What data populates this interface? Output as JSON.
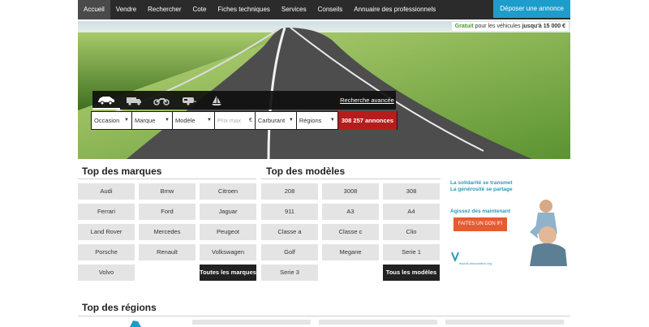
{
  "nav": {
    "items": [
      "Accueil",
      "Vendre",
      "Rechercher",
      "Cote",
      "Fiches techniques",
      "Services",
      "Conseils",
      "Annuaire des professionnels"
    ],
    "post_ad": "Déposer une annonce"
  },
  "promo": {
    "free": "Gratuit",
    "middle": " pour les véhicules ",
    "limit": "jusqu'à 15 000 €"
  },
  "search": {
    "advanced": "Recherche avancée",
    "condition": "Occasion",
    "brand": "Marque",
    "model": "Modèle",
    "price_placeholder": "Prix max",
    "currency": "€",
    "fuel": "Carburant",
    "region": "Régions",
    "count": "308 257 annonces",
    "vehicle_icons": [
      "car-icon",
      "truck-icon",
      "motorbike-icon",
      "caravan-icon",
      "sailboat-icon"
    ]
  },
  "brands": {
    "title": "Top des marques",
    "items": [
      "Audi",
      "Bmw",
      "Citroen",
      "Ferrari",
      "Ford",
      "Jaguar",
      "Land Rover",
      "Mercedes",
      "Peugeot",
      "Porsche",
      "Renault",
      "Volkswagen",
      "Volvo"
    ],
    "all": "Toutes les marques"
  },
  "models": {
    "title": "Top des modèles",
    "items": [
      "208",
      "3008",
      "308",
      "911",
      "A3",
      "A4",
      "Classe a",
      "Classe c",
      "Clio",
      "Golf",
      "Megane",
      "Serie 1",
      "Serie 3"
    ],
    "all": "Tous les modèles"
  },
  "ad": {
    "line1": "La solidarité se transmet",
    "line2": "La générosité se partage",
    "act": "Agissez dès maintenant",
    "button": "FAITES UN DON IFI",
    "url": "depuis-association.org"
  },
  "regions": {
    "title": "Top des régions"
  },
  "colors": {
    "nav_bg": "#2b2b2b",
    "accent_blue": "#1d9dcc",
    "count_red": "#b71c1c",
    "ad_orange": "#e85a30"
  }
}
